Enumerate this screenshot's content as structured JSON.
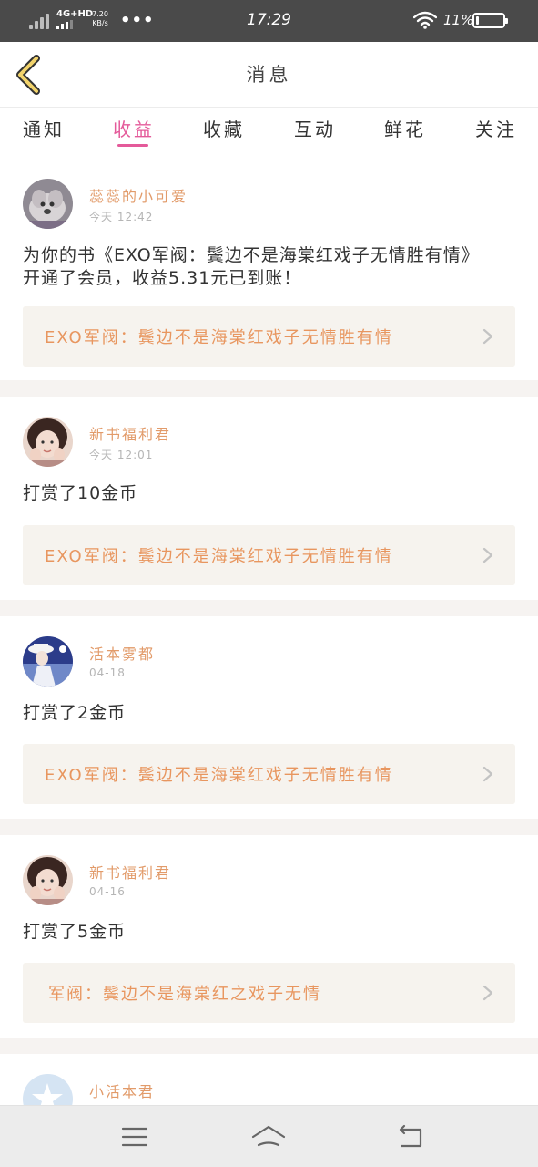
{
  "status_bar": {
    "network_label": "4G+HD",
    "speed_value": "7.20",
    "speed_unit": "KB/s",
    "more_dots": "•••",
    "time": "17:29",
    "battery_percent": "11%",
    "battery_level": 0.11
  },
  "header": {
    "title": "消息",
    "back_icon": "chevron-left-icon"
  },
  "tabs": [
    {
      "label": "通知",
      "active": false
    },
    {
      "label": "收益",
      "active": true
    },
    {
      "label": "收藏",
      "active": false
    },
    {
      "label": "互动",
      "active": false
    },
    {
      "label": "鲜花",
      "active": false
    },
    {
      "label": "关注",
      "active": false
    }
  ],
  "messages": [
    {
      "username": "蕊蕊的小可爱",
      "time": "今天 12:42",
      "text": "为你的书《EXO军阀：鬓边不是海棠红戏子无情胜有情》开通了会员，收益5.31元已到账！",
      "book_title": "EXO军阀：鬓边不是海棠红戏子无情胜有情"
    },
    {
      "username": "新书福利君",
      "time": "今天 12:01",
      "text": "打赏了10金币",
      "book_title": "EXO军阀：鬓边不是海棠红戏子无情胜有情"
    },
    {
      "username": "活本雾都",
      "time": "04-18",
      "text": "打赏了2金币",
      "book_title": "EXO军阀：鬓边不是海棠红戏子无情胜有情"
    },
    {
      "username": "新书福利君",
      "time": "04-16",
      "text": "打赏了5金币",
      "book_title": "军阀：鬓边不是海棠红之戏子无情"
    },
    {
      "username": "小活本君",
      "time": "",
      "text": "",
      "book_title": ""
    }
  ],
  "colors": {
    "accent_pink": "#e45a9a",
    "username_orange": "#e29b6a",
    "book_title_orange": "#e8965f",
    "back_icon_yellow": "#f2d36b"
  },
  "nav_icons": [
    "menu-icon",
    "home-icon",
    "back-arrow-icon"
  ]
}
